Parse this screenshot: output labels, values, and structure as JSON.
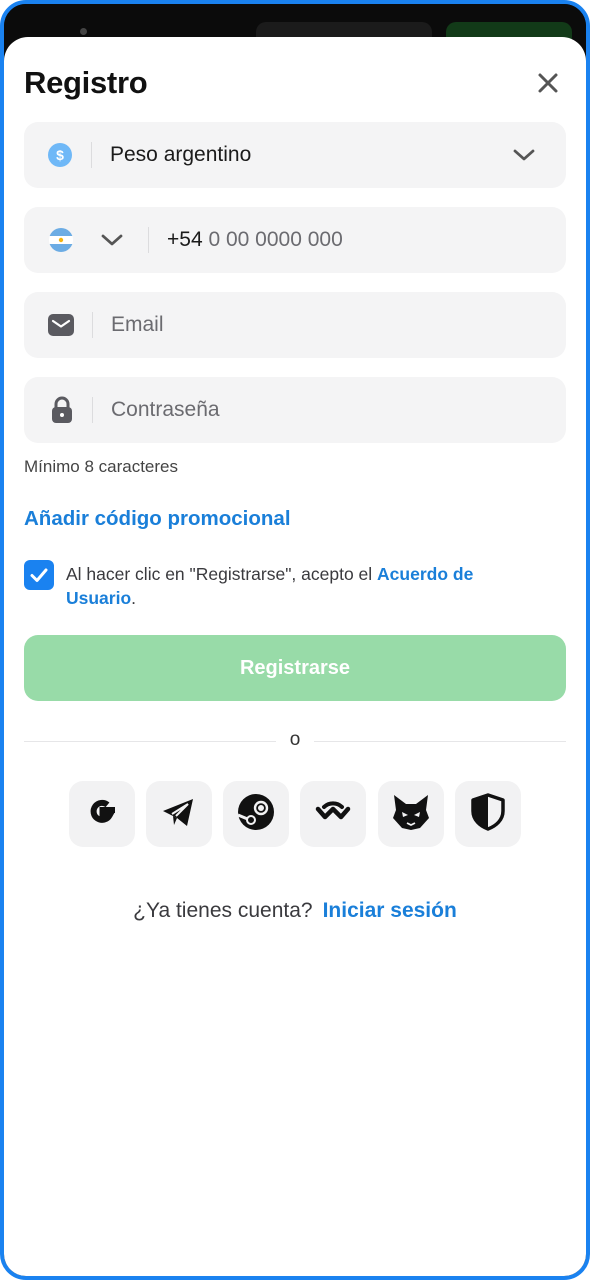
{
  "modal": {
    "title": "Registro"
  },
  "currency": {
    "value": "Peso argentino",
    "icon": "dollar-coin-icon"
  },
  "phone": {
    "prefix": "+54",
    "placeholder": "0 00 0000 000",
    "country_flag": "argentina-flag-icon"
  },
  "email": {
    "placeholder": "Email"
  },
  "password": {
    "placeholder": "Contraseña",
    "hint": "Mínimo 8 caracteres"
  },
  "promo": {
    "label": "Añadir código promocional"
  },
  "terms": {
    "checked": true,
    "text_before": "Al hacer clic en \"Registrarse\", acepto el ",
    "link_text": "Acuerdo de Usuario",
    "text_after": "."
  },
  "submit": {
    "label": "Registrarse",
    "enabled": false
  },
  "divider": {
    "text": "o"
  },
  "social": [
    {
      "name": "google-icon"
    },
    {
      "name": "telegram-icon"
    },
    {
      "name": "steam-icon"
    },
    {
      "name": "walletconnect-icon"
    },
    {
      "name": "metamask-fox-icon"
    },
    {
      "name": "shield-icon"
    }
  ],
  "login": {
    "question": "¿Ya tienes cuenta?",
    "link": "Iniciar sesión"
  },
  "colors": {
    "accent": "#1a82f0",
    "link": "#1a7fd9",
    "submit_disabled": "#98dba8",
    "field_bg": "#f4f4f5"
  }
}
